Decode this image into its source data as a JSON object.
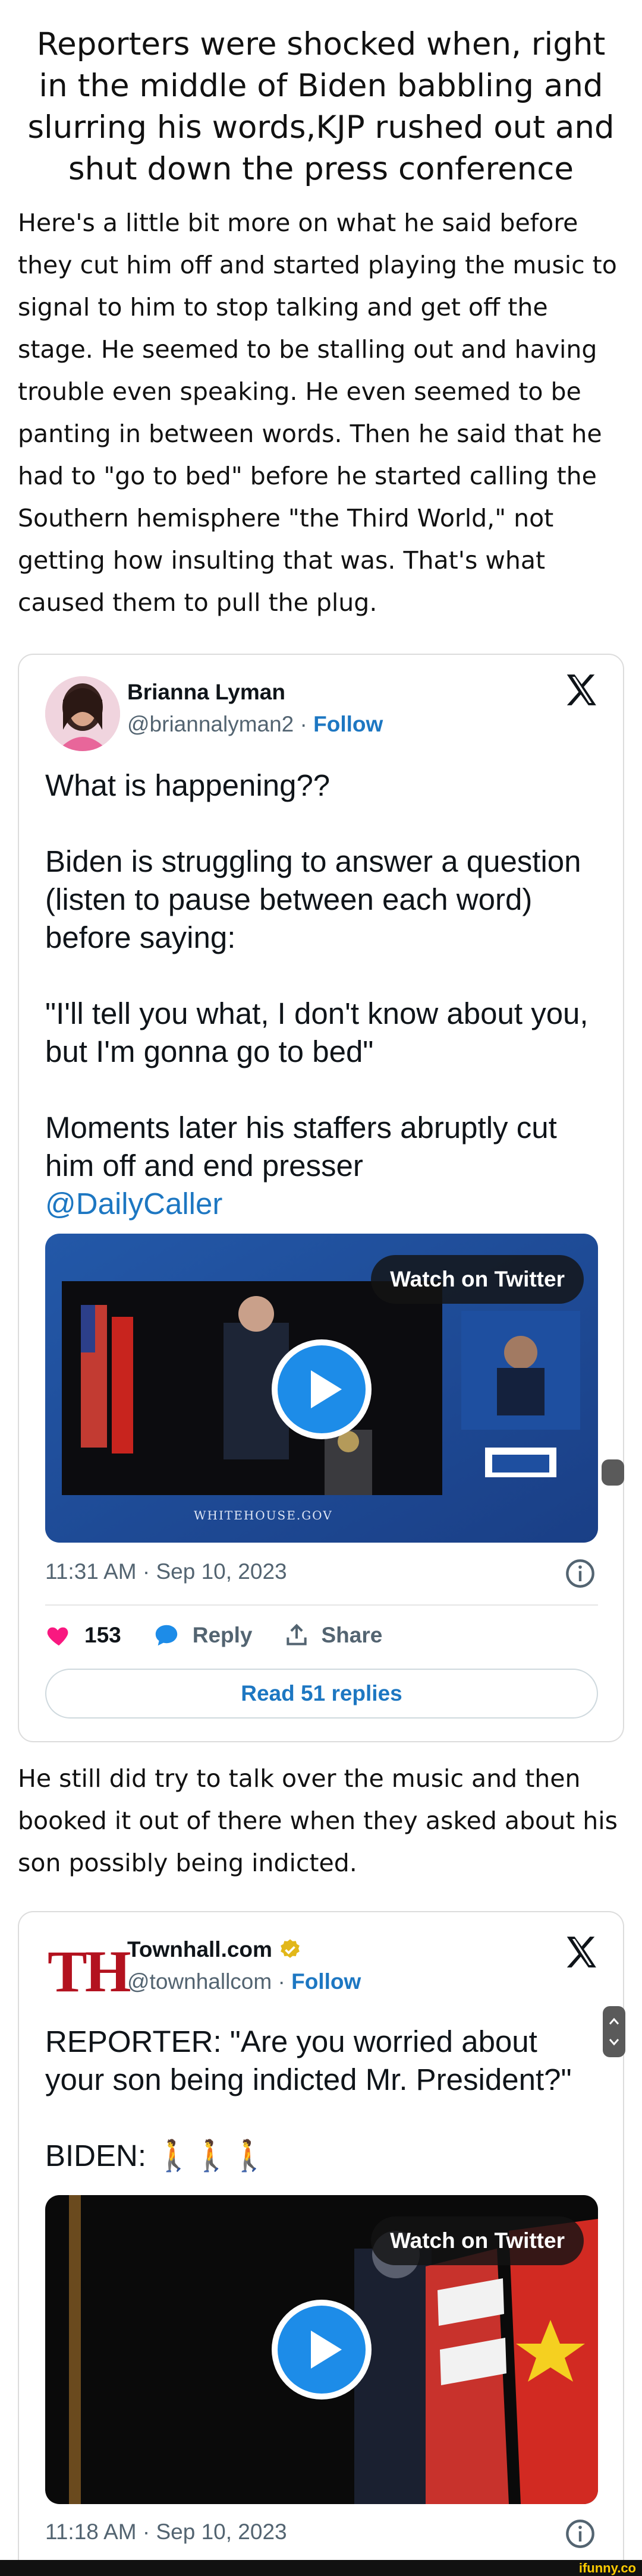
{
  "post": {
    "title": "Reporters were shocked when, right in the middle of Biden babbling and slurring his words,KJP rushed out and shut down the press conference",
    "paragraph1": "Here's a little bit more on what he said before they cut him off and started playing the music to signal to him to stop talking and get off the stage. He seemed to be stalling out and having trouble even speaking. He even seemed to be panting in between words. Then he said that he had to \"go to bed\" before he started calling the Southern hemisphere \"the Third World,\" not getting how insulting that was. That's what caused them to pull the plug.",
    "paragraph2": "He still did try to talk over the music and then booked it out of there when they asked about his son possibly being indicted."
  },
  "tweet1": {
    "name": "Brianna Lyman",
    "handle": "@briannalyman2",
    "separator": "·",
    "follow": "Follow",
    "line1": "What is happening??",
    "line2": "Biden is struggling to answer a question (listen to pause between each word) before saying:",
    "line3": "\"I'll tell you what, I don't know about you, but I'm gonna go to bed\"",
    "line4": "Moments later his staffers abruptly cut him off and end presser",
    "mention": "@DailyCaller",
    "watch_label": "Watch on Twitter",
    "video_caption": "WHITEHOUSE.GOV",
    "timestamp": "11:31 AM · Sep 10, 2023",
    "likes": "153",
    "reply_label": "Reply",
    "share_label": "Share",
    "read_replies": "Read 51 replies"
  },
  "tweet2": {
    "logo_text": "TH",
    "name": "Townhall.com",
    "handle": "@townhallcom",
    "separator": "·",
    "follow": "Follow",
    "line1": "REPORTER: \"Are you worried about your son being indicted Mr. President?\"",
    "line2": "BIDEN: 🚶🚶🚶",
    "watch_label": "Watch on Twitter",
    "timestamp": "11:18 AM · Sep 10, 2023"
  },
  "footer": {
    "brand": "ifunny.co"
  },
  "colors": {
    "link": "#1d77c2",
    "like": "#f91880",
    "verified": "#e2b719"
  }
}
